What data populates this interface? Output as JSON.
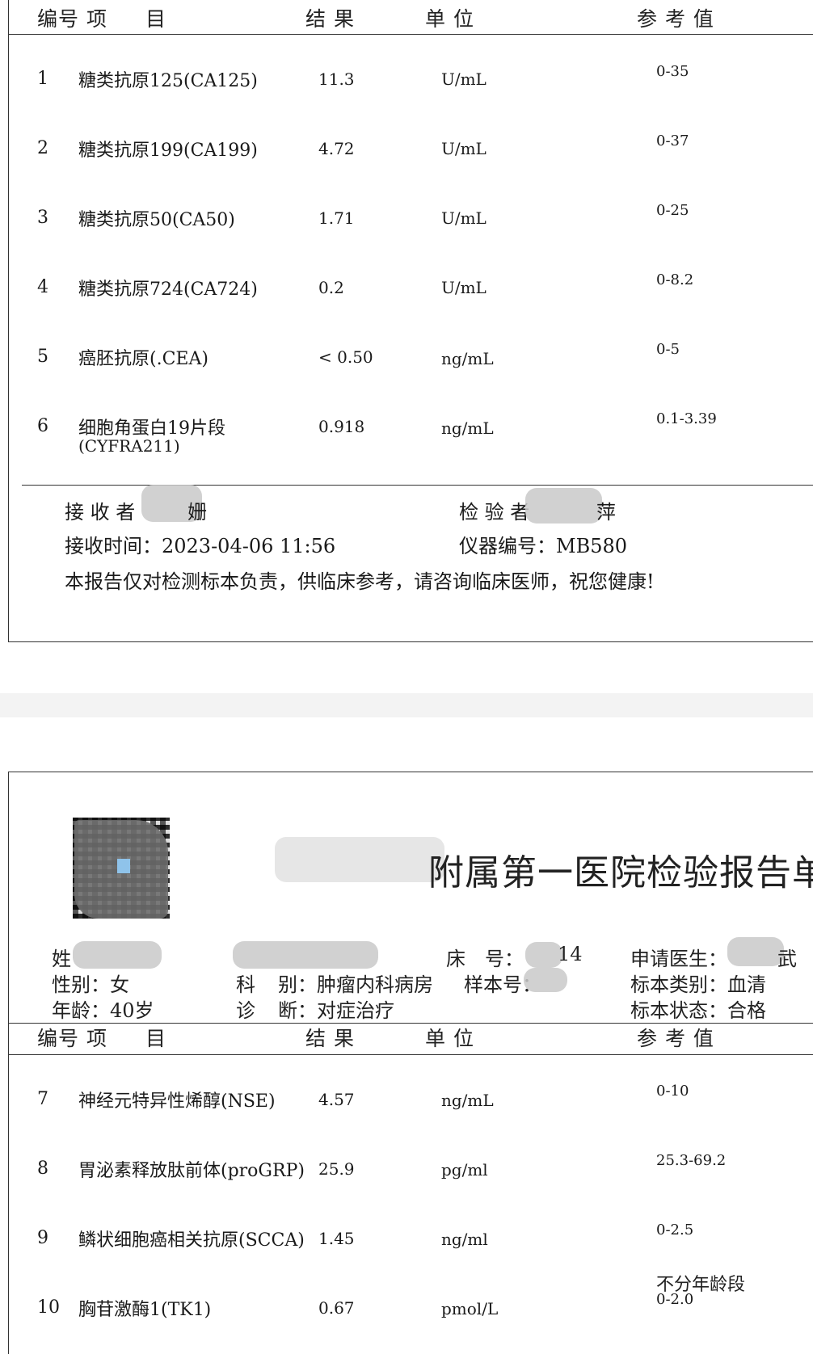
{
  "headers": {
    "code_item": "编号 项",
    "item_tail": "目",
    "result": "结 果",
    "unit": "单 位",
    "reference": "参 考 值"
  },
  "rows_page1": [
    {
      "no": "1",
      "name": "糖类抗原125(CA125)",
      "result": "11.3",
      "unit": "U/mL",
      "ref": "0-35"
    },
    {
      "no": "2",
      "name": "糖类抗原199(CA199)",
      "result": "4.72",
      "unit": "U/mL",
      "ref": "0-37"
    },
    {
      "no": "3",
      "name": "糖类抗原50(CA50)",
      "result": "1.71",
      "unit": "U/mL",
      "ref": "0-25"
    },
    {
      "no": "4",
      "name": "糖类抗原724(CA724)",
      "result": "0.2",
      "unit": "U/mL",
      "ref": "0-8.2"
    },
    {
      "no": "5",
      "name": "癌胚抗原(.CEA)",
      "result": "< 0.50",
      "unit": "ng/mL",
      "ref": "0-5"
    },
    {
      "no": "6",
      "name": "细胞角蛋白19片段",
      "name2": "(CYFRA211)",
      "result": "0.918",
      "unit": "ng/mL",
      "ref": "0.1-3.39"
    }
  ],
  "footer": {
    "receiver_label": "接 收 者",
    "receiver_tail": "姗",
    "tester_label": "检 验 者",
    "tester_tail": "萍",
    "receive_time": "接收时间：2023-04-06 11:56",
    "instrument": "仪器编号：MB580",
    "notice": "本报告仅对检测标本负责，供临床参考，请咨询临床医师，祝您健康!"
  },
  "page2": {
    "title_visible": "附属第一医院检验报告单",
    "info": {
      "name_label": "姓",
      "bed_label": "床　号：",
      "bed_tail": "14",
      "doctor_label": "申请医生：",
      "doctor_tail": "武",
      "gender": "性别：女",
      "dept_label": "科",
      "dept": "别：肿瘤内科病房",
      "sample_no": "样本号：",
      "sample_type": "标本类别：血清",
      "age": "年龄：40岁",
      "diag_label": "诊",
      "diag": "断：对症治疗",
      "sample_state": "标本状态：合格"
    }
  },
  "rows_page2": [
    {
      "no": "7",
      "name": "神经元特异性烯醇(NSE)",
      "result": "4.57",
      "unit": "ng/mL",
      "ref": "0-10"
    },
    {
      "no": "8",
      "name": "胃泌素释放肽前体(proGRP)",
      "result": "25.9",
      "unit": "pg/ml",
      "ref": "25.3-69.2"
    },
    {
      "no": "9",
      "name": "鳞状细胞癌相关抗原(SCCA)",
      "result": "1.45",
      "unit": "ng/ml",
      "ref": "0-2.5"
    },
    {
      "no": "10",
      "name": "胸苷激酶1(TK1)",
      "result": "0.67",
      "unit": "pmol/L",
      "ref_note": "不分年龄段",
      "ref": "0-2.0"
    }
  ]
}
